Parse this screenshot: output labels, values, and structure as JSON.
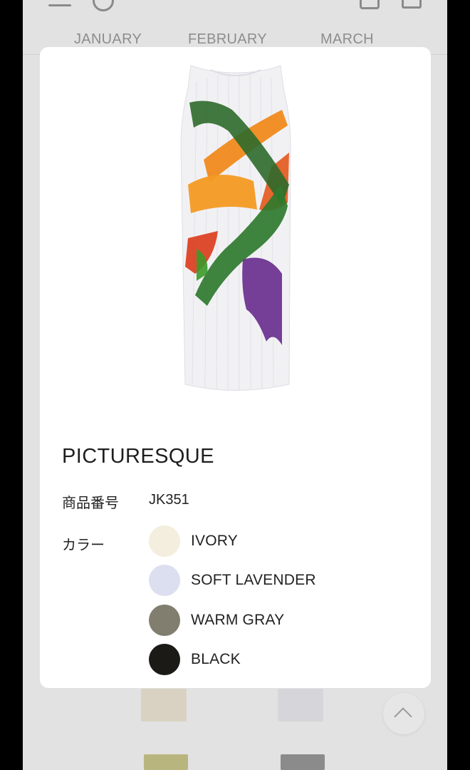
{
  "header": {
    "months": [
      "JANUARY",
      "FEBRUARY",
      "MARCH"
    ]
  },
  "product": {
    "name": "PICTURESQUE",
    "sku_label": "商品番号",
    "sku": "JK351",
    "color_label": "カラー",
    "colors": [
      {
        "name": "IVORY",
        "hex": "#f3eedd"
      },
      {
        "name": "SOFT LAVENDER",
        "hex": "#dcdff0"
      },
      {
        "name": "WARM GRAY",
        "hex": "#827e6f"
      },
      {
        "name": "BLACK",
        "hex": "#1c1a17"
      }
    ]
  },
  "icons": {
    "header": [
      "menu-icon",
      "search-icon",
      "bag-icon",
      "cart-icon"
    ],
    "scroll_top": "chevron-up-icon"
  }
}
